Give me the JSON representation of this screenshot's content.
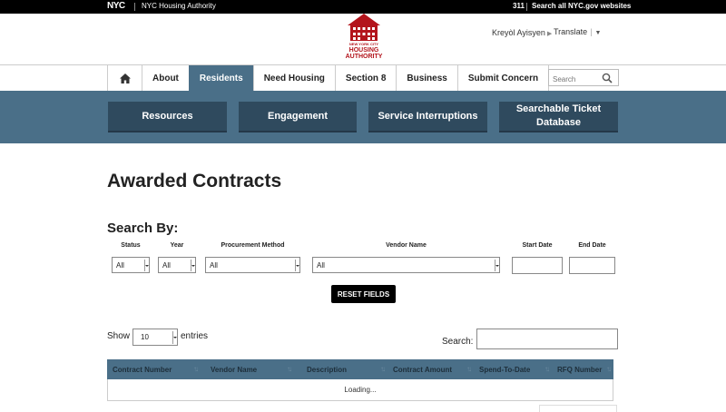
{
  "topbar": {
    "nyc": "NYC",
    "agency": "NYC Housing Authority",
    "n311": "311",
    "search_all": "Search all NYC.gov websites"
  },
  "header": {
    "logo_line1": "NEW YORK CITY",
    "logo_line2": "HOUSING",
    "logo_line3": "AUTHORITY",
    "language": "Kreyòl Ayisyen",
    "translate": "Translate"
  },
  "nav": {
    "items": [
      "About",
      "Residents",
      "Need Housing",
      "Section 8",
      "Business",
      "Submit Concern"
    ],
    "active": "Residents",
    "search_placeholder": "Search"
  },
  "subnav": {
    "items": [
      "Resources",
      "Engagement",
      "Service Interruptions",
      "Searchable Ticket Database"
    ]
  },
  "page": {
    "title": "Awarded Contracts",
    "search_by": "Search By:"
  },
  "filters": {
    "status_label": "Status",
    "status_value": "All",
    "year_label": "Year",
    "year_value": "All",
    "procurement_label": "Procurement Method",
    "procurement_value": "All",
    "vendor_label": "Vendor Name",
    "vendor_value": "All",
    "start_label": "Start Date",
    "end_label": "End Date",
    "reset": "RESET FIELDS"
  },
  "table_controls": {
    "show": "Show",
    "entries_value": "10",
    "entries": "entries",
    "search": "Search:"
  },
  "table": {
    "columns": [
      "Contract Number",
      "Vendor Name",
      "Description",
      "Contract Amount",
      "Spend-To-Date",
      "RFQ Number"
    ],
    "loading": "Loading..."
  },
  "colors": {
    "nav_active": "#4a6f88",
    "subnav_button": "#2f4a5e",
    "brand_red": "#b3141c"
  }
}
